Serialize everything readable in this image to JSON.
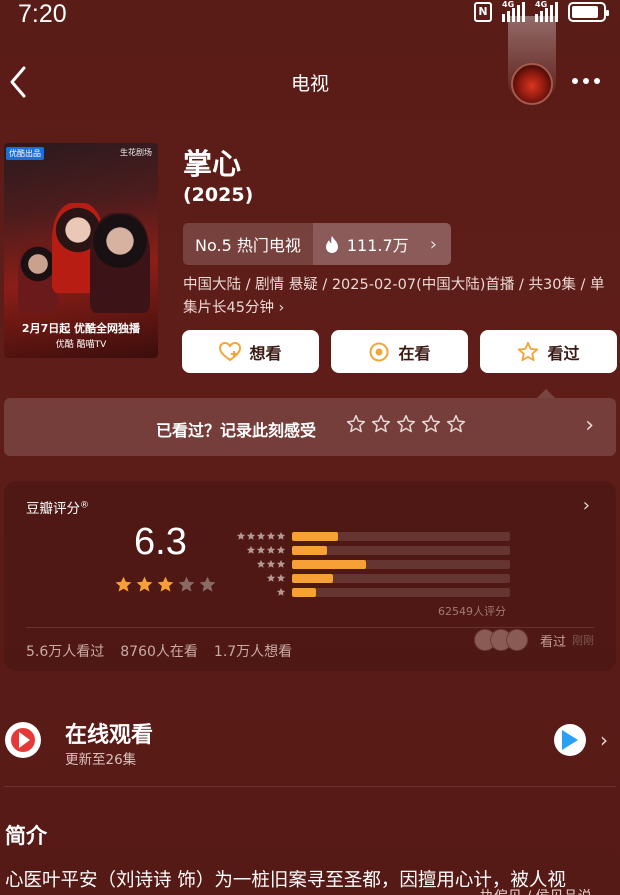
{
  "status_bar": {
    "time": "7:20",
    "network1": "4G",
    "network2": "4G"
  },
  "nav": {
    "title": "电视"
  },
  "poster": {
    "tag": "优酷出品",
    "studio": "生花剧场",
    "caption": "2月7日起 优酷全网独播",
    "platforms": "优酷  酷喵TV"
  },
  "show": {
    "title": "掌心",
    "year": "(2025)",
    "rank": "No.5 热门电视",
    "heat": "111.7万",
    "meta": "中国大陆 / 剧情 悬疑 / 2025-02-07(中国大陆)首播 / 共30集 / 单集片长45分钟 ›"
  },
  "actions": {
    "want": "想看",
    "watching": "在看",
    "watched": "看过"
  },
  "seen_prompt": {
    "text": "已看过？记录此刻感受"
  },
  "rating": {
    "label": "豆瓣评分",
    "score": "6.3",
    "stars": 3,
    "distribution": [
      0.21,
      0.16,
      0.34,
      0.19,
      0.11
    ],
    "votes": "62549人评分",
    "stats": {
      "watched": "5.6万人看过",
      "watching": "8760人在看",
      "want": "1.7万人想看"
    },
    "recent": {
      "action": "看过",
      "time": "刚刚"
    }
  },
  "online": {
    "title": "在线观看",
    "update": "更新至26集"
  },
  "intro": {
    "heading": "简介",
    "text": "心医叶平安（刘诗诗 饰）为一桩旧案寻至圣都，因擅用心计，被人视",
    "text_tail": "执偏见 / 侯见品说"
  },
  "colors": {
    "accent_star": "#f7a035",
    "background": "#5a1c17",
    "play_red": "#e53939"
  }
}
